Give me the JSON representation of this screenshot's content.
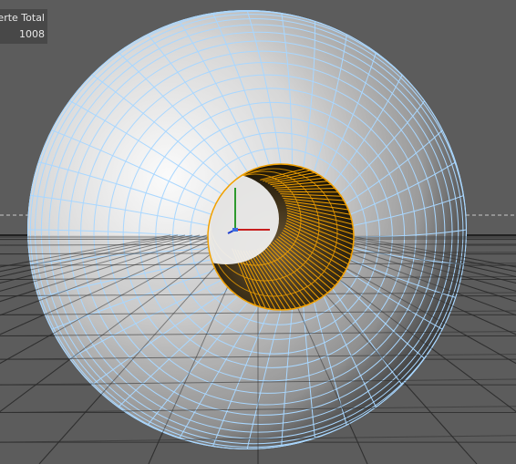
{
  "hud": {
    "header": "ertices Selektierte Total",
    "visible_header": "ierte Total",
    "total_value": "1008"
  },
  "colors": {
    "background": "#5c5c5c",
    "wireframe": "#a9d7ff",
    "selection": "#f0a000",
    "ground_line": "#2b2b2b",
    "horizon_dash": "#bfbfbf"
  },
  "icons": {
    "axis_gizmo": "xyz-axis-icon"
  }
}
